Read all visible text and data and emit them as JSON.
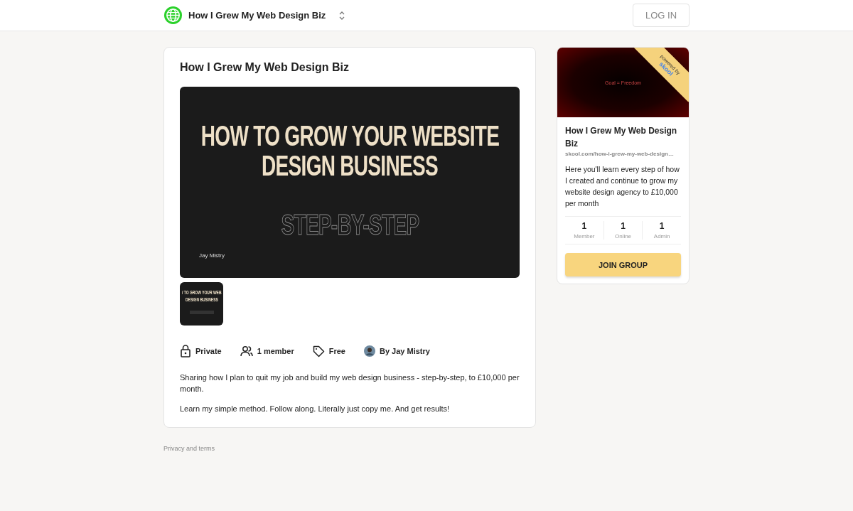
{
  "header": {
    "group_name": "How I Grew My Web Design Biz",
    "login": "LOG IN"
  },
  "main": {
    "title": "How I Grew My Web Design Biz",
    "slide": {
      "headline": [
        "HOW TO GROW YOUR WEBSITE",
        "DESIGN BUSINESS"
      ],
      "subtitle": "STEP-BY-STEP",
      "author": "Jay Mistry"
    },
    "thumbnails": [
      {
        "lines": [
          "/ TO GROW YOUR WEB",
          "DESIGN BUSINESS"
        ]
      }
    ],
    "meta": [
      {
        "kind": "lock",
        "label": "Private"
      },
      {
        "kind": "members",
        "label": "1 member"
      },
      {
        "kind": "tag",
        "label": "Free"
      },
      {
        "kind": "avatar",
        "label": "By Jay Mistry"
      }
    ],
    "description": [
      "Sharing how I plan to quit my job and build my web design business - step-by-step, to £10,000 per month.",
      "Learn my simple method. Follow along. Literally just copy me. And get results!"
    ]
  },
  "footer": {
    "link": "Privacy and terms"
  },
  "side_card": {
    "cover_text": "Goal = Freedom",
    "ribbon": [
      "powered by",
      "skool"
    ],
    "title": "How I Grew My Web Design Biz",
    "url": "skool.com/how-i-grew-my-web-design…",
    "description": "Here you'll learn every step of how I created and continue to grow my website design agency to £10,000 per month",
    "stats": [
      {
        "value": "1",
        "label": "Member"
      },
      {
        "value": "1",
        "label": "Online"
      },
      {
        "value": "1",
        "label": "Admin"
      }
    ],
    "button": "JOIN GROUP"
  }
}
